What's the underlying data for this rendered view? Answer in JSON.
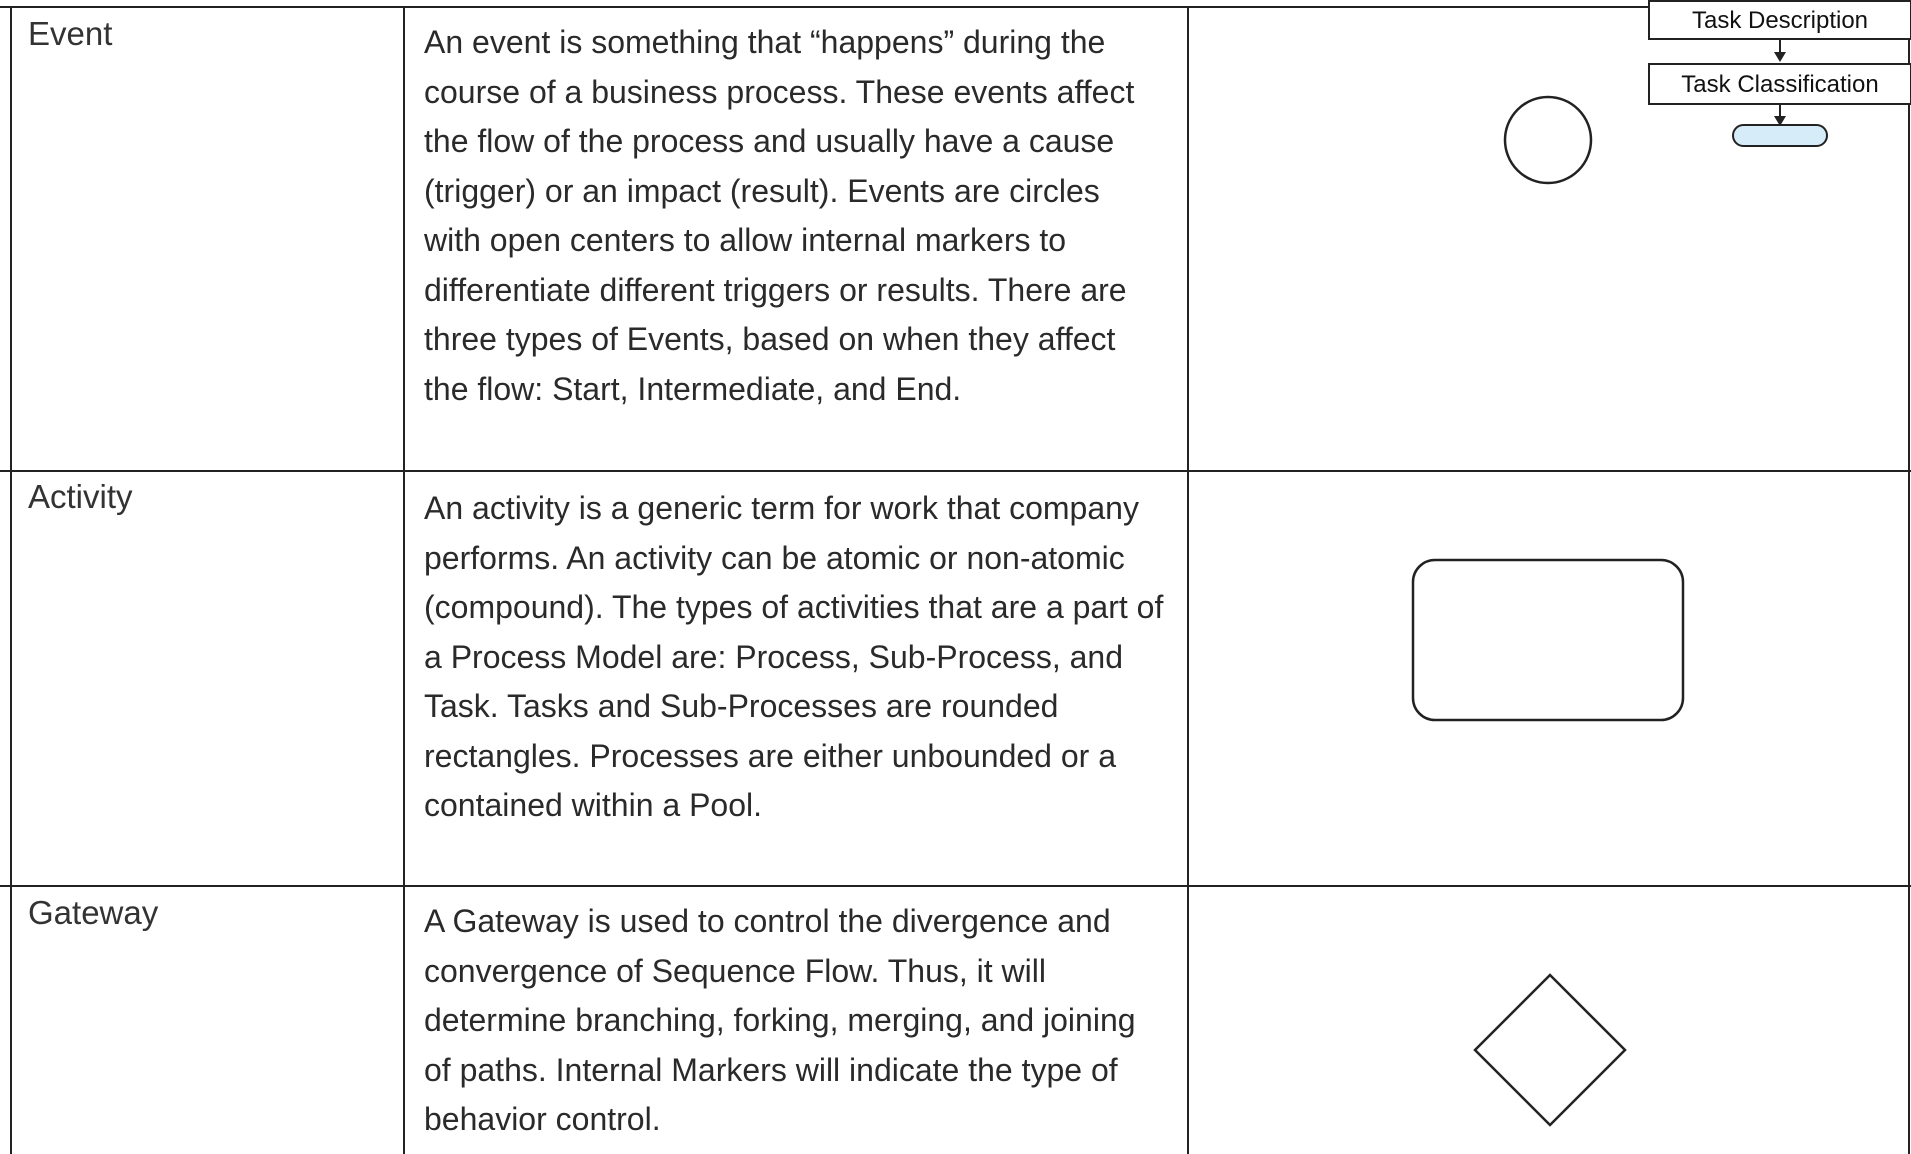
{
  "rows": [
    {
      "term": "Event",
      "description": "An event is something that “happens” during the course of a business process. These events affect the flow of the process and usually have a cause (trigger) or an impact (result). Events are circles with open centers to allow internal markers to differentiate different triggers or results. There are three types of Events, based on when they affect the flow: Start, Intermediate, and End.",
      "shape_icon": "circle"
    },
    {
      "term": "Activity",
      "description": "An activity is a generic term for work that company performs. An activity can be atomic or non-atomic (compound). The types of activities that are a part of a Process Model are: Process, Sub-Process, and Task. Tasks and Sub-Processes are rounded rectangles. Processes are either unbounded or a contained within a Pool.",
      "shape_icon": "rounded-rectangle"
    },
    {
      "term": "Gateway",
      "description": "A Gateway is used to control the divergence and convergence of Sequence Flow. Thus, it will determine branching, forking, merging, and joining of paths. Internal Markers will indicate the type of behavior control.",
      "shape_icon": "diamond"
    }
  ],
  "flowchart": {
    "box1_label": "Task Description",
    "box2_label": "Task Classification",
    "terminator_icon": "terminator-pill",
    "terminator_color": "#d6ecf8"
  },
  "colors": {
    "line": "#222222",
    "text": "#2a2a2a"
  }
}
